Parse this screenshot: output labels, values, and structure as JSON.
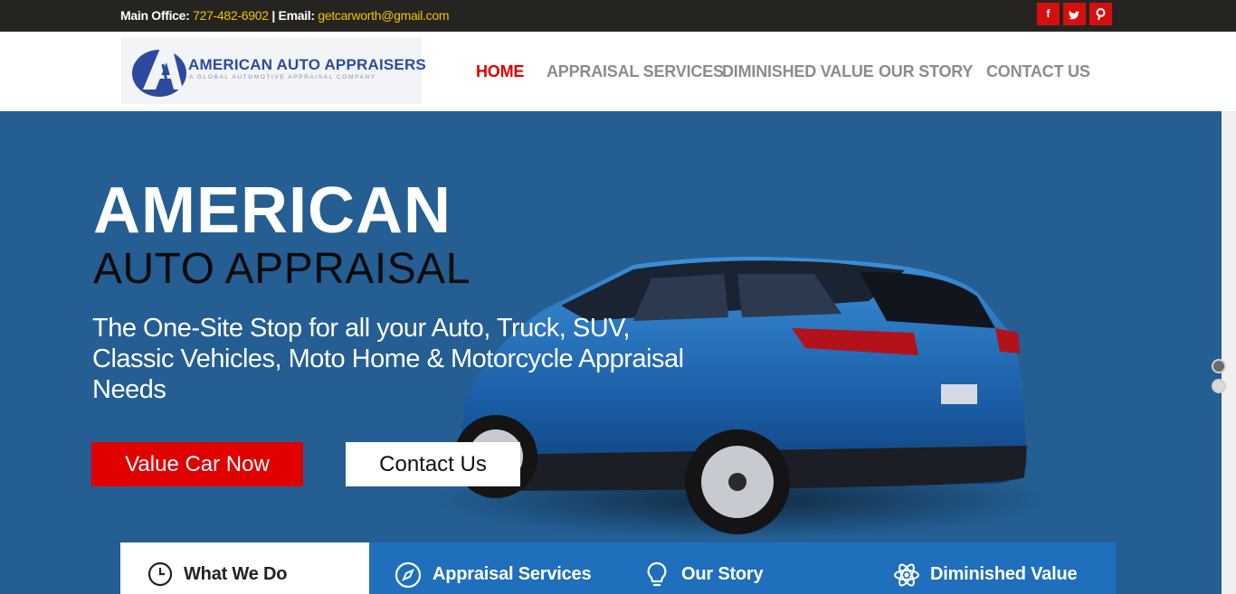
{
  "topbar": {
    "office_label": "Main Office:",
    "phone": "727-482-6902",
    "separator": "|",
    "email_label": "Email:",
    "email": "getcarworth@gmail.com",
    "social": [
      {
        "icon": "facebook-icon",
        "glyph": "f"
      },
      {
        "icon": "twitter-icon",
        "glyph": "t"
      },
      {
        "icon": "pinterest-icon",
        "glyph": "p"
      }
    ]
  },
  "logo": {
    "title": "AMERICAN AUTO APPRAISERS",
    "subtitle": "A GLOBAL AUTOMOTIVE APPRAISAL COMPANY"
  },
  "nav": {
    "items": [
      {
        "label": "HOME",
        "active": true
      },
      {
        "label": "APPRAISAL SERVICES",
        "active": false
      },
      {
        "label": "DIMINISHED VALUE",
        "active": false
      },
      {
        "label": "OUR STORY",
        "active": false
      },
      {
        "label": "CONTACT US",
        "active": false
      }
    ]
  },
  "hero": {
    "heading1": "AMERICAN",
    "heading2": "AUTO APPRAISAL",
    "tagline": "The One-Site Stop for all your Auto, Truck, SUV, Classic Vehicles, Moto Home & Motorcycle Appraisal Needs",
    "primary_button": "Value Car Now",
    "secondary_button": "Contact Us"
  },
  "tabs": [
    {
      "label": "What We Do",
      "icon": "clock-icon"
    },
    {
      "label": "Appraisal Services",
      "icon": "compass-icon"
    },
    {
      "label": "Our Story",
      "icon": "lightbulb-icon"
    },
    {
      "label": "Diminished Value",
      "icon": "atom-icon"
    }
  ],
  "colors": {
    "accent_red": "#e00000",
    "hero_blue": "#245e93",
    "tab_blue": "#1f6fbd",
    "topbar": "#262420",
    "highlight_yellow": "#f2c400"
  }
}
